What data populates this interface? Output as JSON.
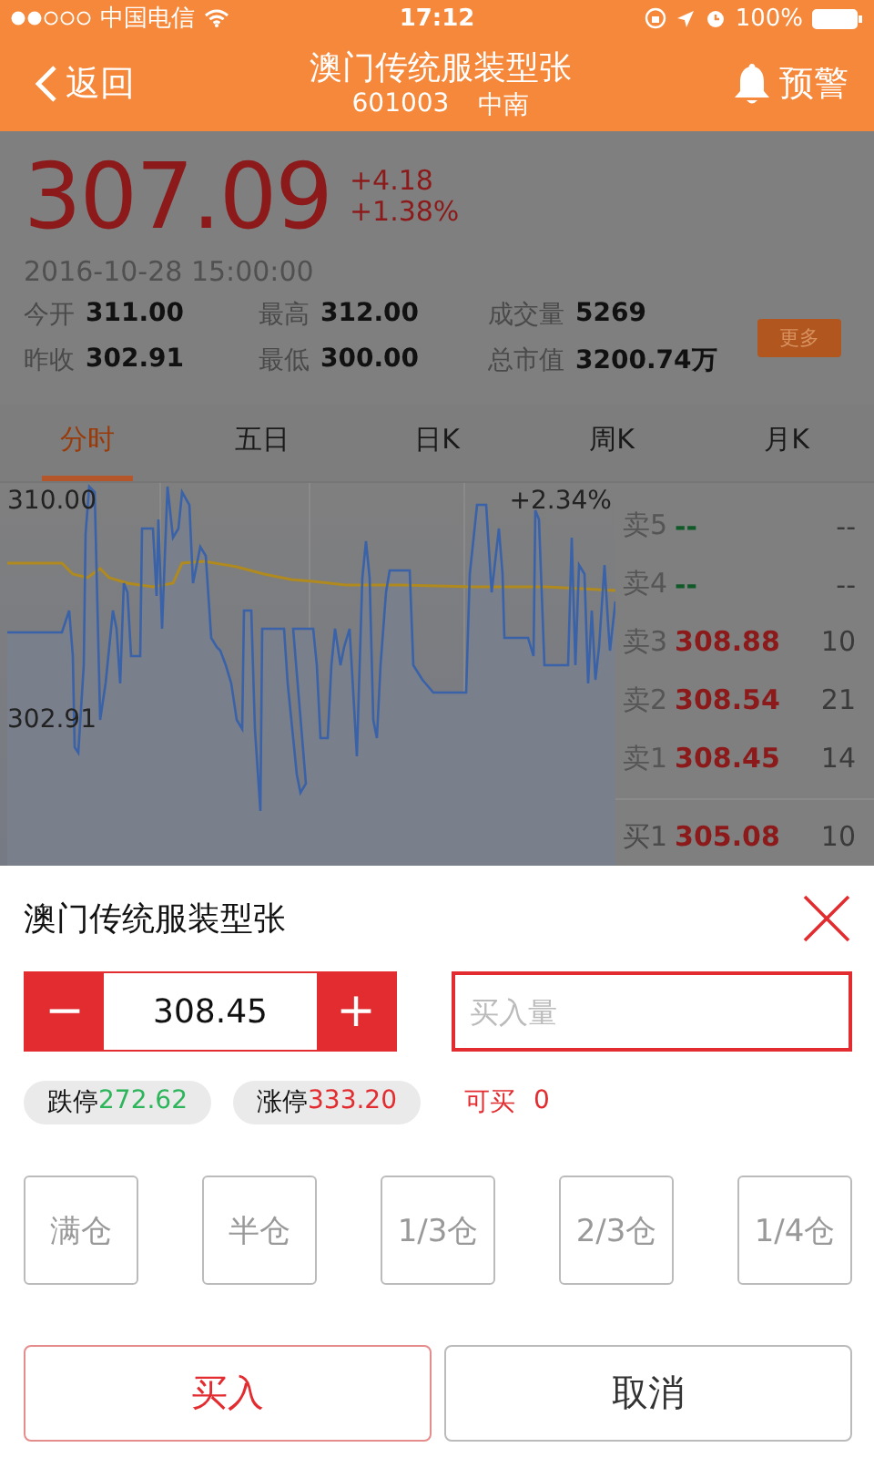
{
  "status_bar": {
    "carrier": "中国电信",
    "time": "17:12",
    "battery": "100%"
  },
  "header": {
    "back": "返回",
    "title": "澳门传统服装型张",
    "code": "601003",
    "name": "中南",
    "alert": "预警"
  },
  "quote": {
    "price": "307.09",
    "change": "+4.18",
    "change_percent": "+1.38%",
    "datetime": "2016-10-28 15:00:00",
    "stats": [
      {
        "label": "今开",
        "value": "311.00"
      },
      {
        "label": "最高",
        "value": "312.00"
      },
      {
        "label": "成交量",
        "value": "5269"
      },
      {
        "label": "昨收",
        "value": "302.91"
      },
      {
        "label": "最低",
        "value": "300.00"
      },
      {
        "label": "总市值",
        "value": "3200.74万"
      }
    ],
    "more": "更多"
  },
  "tabs": [
    {
      "label": "分时",
      "selected": true
    },
    {
      "label": "五日",
      "selected": false
    },
    {
      "label": "日K",
      "selected": false
    },
    {
      "label": "周K",
      "selected": false
    },
    {
      "label": "月K",
      "selected": false
    }
  ],
  "chart": {
    "high_label": "310.00",
    "base_label": "302.91",
    "percent_label": "+2.34%"
  },
  "order_book": [
    {
      "kind": "sell",
      "label": "卖5",
      "price": "--",
      "volume": "--",
      "color": "#0f5a28"
    },
    {
      "kind": "sell",
      "label": "卖4",
      "price": "--",
      "volume": "--",
      "color": "#0f5a28"
    },
    {
      "kind": "sell",
      "label": "卖3",
      "price": "308.88",
      "volume": "10",
      "color": "#8c1a1a"
    },
    {
      "kind": "sell",
      "label": "卖2",
      "price": "308.54",
      "volume": "21",
      "color": "#8c1a1a"
    },
    {
      "kind": "sell",
      "label": "卖1",
      "price": "308.45",
      "volume": "14",
      "color": "#8c1a1a"
    },
    {
      "kind": "buy",
      "label": "买1",
      "price": "305.08",
      "volume": "10",
      "color": "#8c1a1a"
    }
  ],
  "order_form": {
    "title": "澳门传统服装型张",
    "minus": "−",
    "price": "308.45",
    "plus": "+",
    "quantity": {
      "placeholder": "买入量"
    },
    "limit_down": {
      "label": "跌停",
      "value": "272.62"
    },
    "limit_up": {
      "label": "涨停",
      "value": "333.20"
    },
    "available": {
      "label": "可买",
      "value": "0"
    },
    "positions": [
      "满仓",
      "半仓",
      "1/3仓",
      "2/3仓",
      "1/4仓"
    ],
    "buttons": [
      {
        "label": "买入",
        "kind": "primary"
      },
      {
        "label": "取消",
        "kind": "secondary"
      }
    ]
  }
}
